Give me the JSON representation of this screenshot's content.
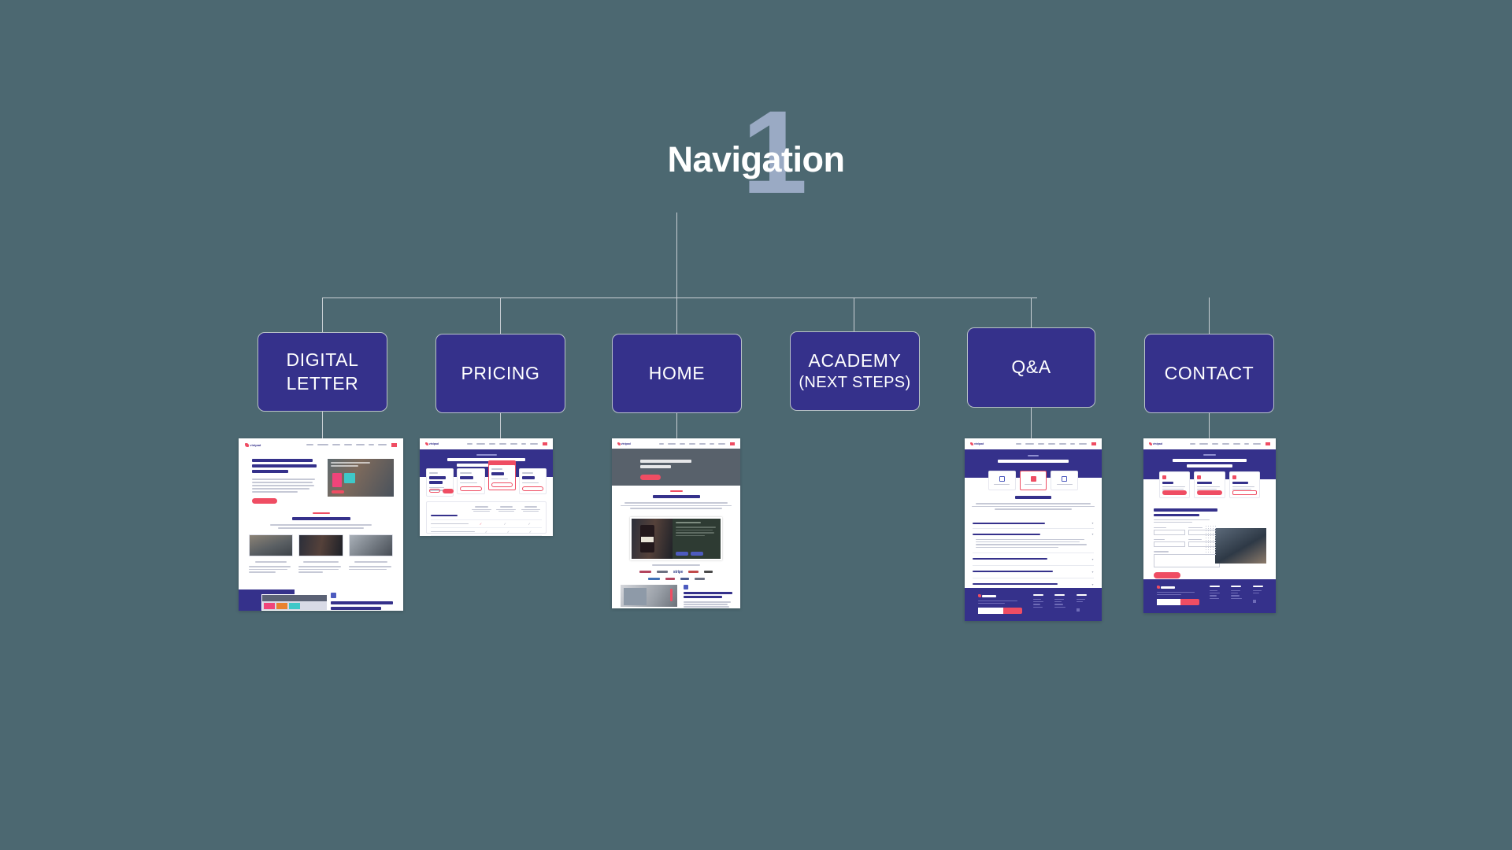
{
  "page": {
    "background_color": "#4c6871",
    "node_color": "#35318b",
    "accent_color": "#ef4d63",
    "connector_color": "#c9cfd4"
  },
  "header": {
    "title": "Navigation",
    "step_number": "1"
  },
  "nodes": [
    {
      "id": "digital-letter",
      "label": "DIGITAL",
      "label2": "LETTER",
      "sub": ""
    },
    {
      "id": "pricing",
      "label": "PRICING",
      "label2": "",
      "sub": ""
    },
    {
      "id": "home",
      "label": "HOME",
      "label2": "",
      "sub": ""
    },
    {
      "id": "academy",
      "label": "ACADEMY",
      "label2": "",
      "sub": "(NEXT STEPS)"
    },
    {
      "id": "qa",
      "label": "Q&A",
      "label2": "",
      "sub": ""
    },
    {
      "id": "contact",
      "label": "CONTACT",
      "label2": "",
      "sub": ""
    }
  ],
  "thumbnails": {
    "digital_letter": {
      "brand": "vinipad",
      "hero_heading": "Vinipad mejora la experiencia del cliente a la hora de elegir",
      "cta": "Saber más",
      "section_eyebrow": "SERVICIO",
      "section_heading": "Te explicamos nuestro servicio",
      "feature_1": "Carta digital personalizada",
      "feature_2": "Encuentra, elige y bebe",
      "feature_3": "Mantenla al día de productos",
      "bottom_heading": "Influye positivamente en el ticket medio por consumo"
    },
    "pricing": {
      "brand": "vinipad",
      "hero_eyebrow": "Tarifas y planes",
      "hero_heading": "Selecciona el método de pago que mejor se adapte a ti.",
      "plans": [
        {
          "name": "GRATIS",
          "title": "Escoge tu tarifa",
          "price": "",
          "note": "Prueba sin límite",
          "cta": "Empezar"
        },
        {
          "name": "ESENCIAL",
          "price": "24,90€",
          "period": "/mes",
          "note": "Sin IVA, por local",
          "cta": "Quiero este plan"
        },
        {
          "name": "ESTÁNDAR",
          "price": "24,90€",
          "period": "/mes",
          "note": "Sin IVA, por local",
          "cta": "Quiero este plan",
          "badge": "Recomendado"
        },
        {
          "name": "PREMIUM",
          "price": "45,90€",
          "period": "/mes",
          "note": "Sin IVA, por local",
          "cta": "Quiero este plan"
        }
      ],
      "compare_columns": [
        "Esencial",
        "Estándar",
        "Premium"
      ],
      "compare_group_1": "Servicios",
      "compare_group_2": "Productos"
    },
    "home": {
      "brand": "vinipad",
      "hero_heading": "Aumenta tu ticket medio con Vinipad",
      "hero_cta": "Empezar ahora",
      "section_heading": "El secreto está en el vino",
      "partners_label": "Confían en nosotros",
      "partners": [
        "stripe"
      ],
      "video_heading": "Ten toda tu carta digital siempre actualizada"
    },
    "qa": {
      "brand": "vinipad",
      "hero_eyebrow": "FAQ",
      "hero_heading": "Hola, ¿cómo podemos ayudar?",
      "categories": [
        "Carta digital",
        "Precios y planes",
        "Uso y soporte"
      ],
      "section_heading": "Precios y planes",
      "questions": [
        "¿Cuánto tiempo dura la prueba gratuita?",
        "¿Puedo cambiar de plan en cualquier momento?",
        "¿Hay algún compromiso de permanencia o contrato mínimo?",
        "¿Cómo se factura el importe y qué métodos de pago aceptáis?",
        "¿Se aplican tarifas por local o por establecimiento de la cadena?"
      ]
    },
    "contact": {
      "brand": "vinipad",
      "hero_eyebrow": "CONTACTO",
      "hero_heading": "Contacta con nosotros cuando lo necesites",
      "channels": [
        {
          "title": "Chat",
          "cta": "Iniciar conversación"
        },
        {
          "title": "Correo",
          "cta": "Enviar correo"
        },
        {
          "title": "Teléfono",
          "cta": "Llamar ahora"
        }
      ],
      "form_heading": "Habla con nuestro departamento de Clientes & Marketing",
      "form_fields": [
        "Nombre",
        "Apellidos",
        "Email",
        "Teléfono",
        "Mensaje"
      ],
      "form_cta": "Enviar mensaje"
    }
  }
}
